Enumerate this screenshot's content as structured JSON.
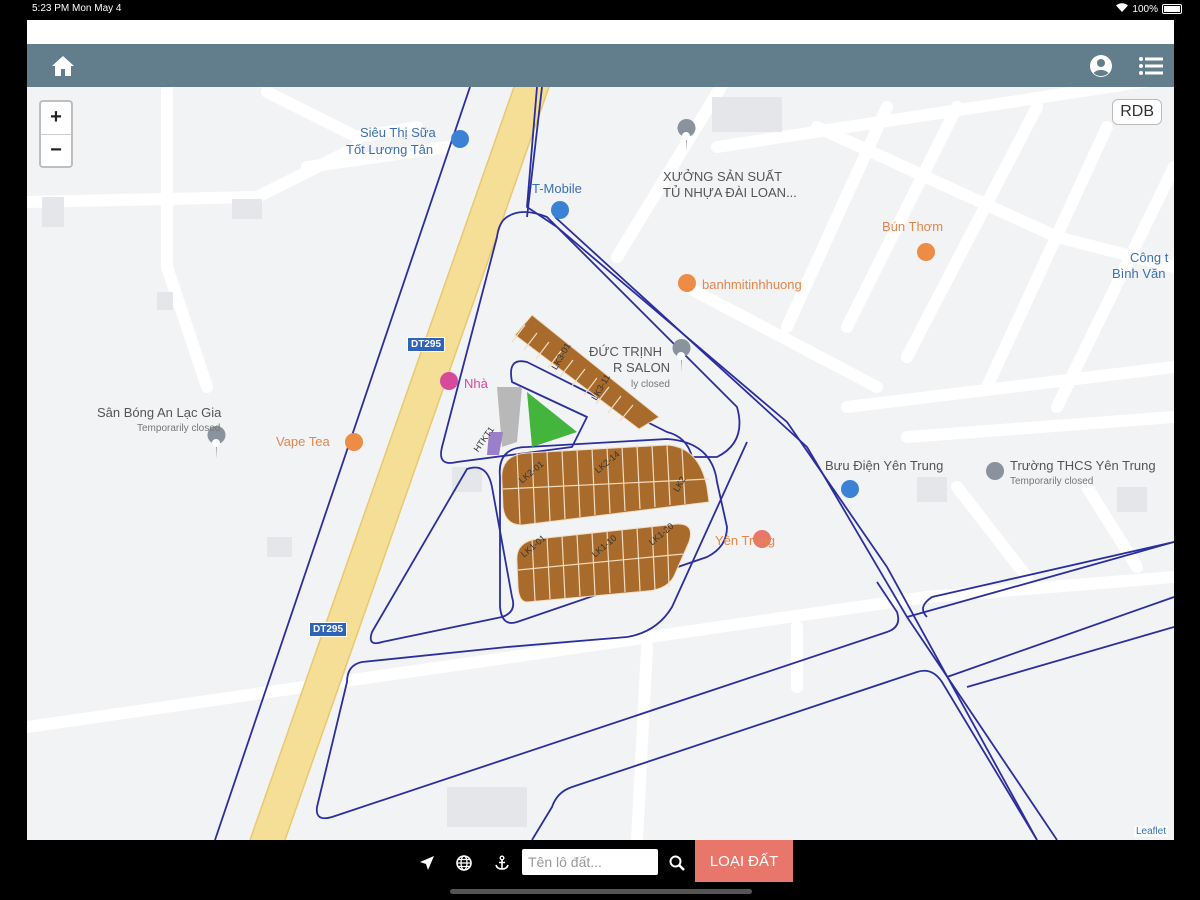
{
  "status_bar": {
    "time_date": "5:23 PM   Mon May 4",
    "battery": "100%"
  },
  "navbar": {
    "home_icon": "home-icon",
    "account_icon": "account-circle-icon",
    "menu_icon": "list-menu-icon"
  },
  "map": {
    "zoom_in": "+",
    "zoom_out": "−",
    "rdb_label": "RDB",
    "attribution": "Leaflet",
    "road_shields": [
      "DT295",
      "DT295"
    ],
    "labels": {
      "sieu_thi_1": "Siêu Thị Sữa",
      "sieu_thi_2": "Tốt Lương Tân",
      "tmobile": "T-Mobile",
      "xuong_1": "XƯỞNG SẢN SUẤT",
      "xuong_2": "TỦ NHỰA ĐÀI LOAN...",
      "bun_thom": "Bún Thơm",
      "cong_1": "Công t",
      "cong_2": "Bình Văn",
      "banhmi": "banhmitinhhuong",
      "duc_trinh_1": "ĐỨC TRỊNH",
      "duc_trinh_2": "R SALON",
      "duc_trinh_status": "ly closed",
      "nha": "Nhà",
      "san_bong": "Sân Bóng An Lạc Gia",
      "san_bong_status": "Temporarily closed",
      "vape": "Vape Tea",
      "buu_dien": "Bưu Điện Yên Trung",
      "truong": "Trường THCS Yên Trung",
      "truong_status": "Temporarily closed",
      "yen_trung": "Yên Trung"
    },
    "lot_labels": [
      "LK3-01",
      "LK3-11",
      "LK2-01",
      "LK2-14",
      "LK2",
      "LK1-01",
      "LK1-10",
      "LK1-20",
      "HTKT1"
    ],
    "colors": {
      "lot": "#a86b2c",
      "green_area": "#44b53c",
      "road_outline": "#2b2f9e",
      "highway": "#f5de96",
      "navbar": "#627d8c",
      "loai_button": "#e8766a"
    }
  },
  "toolbar": {
    "locate_icon": "navigation-arrow-icon",
    "globe_icon": "globe-icon",
    "anchor_icon": "anchor-icon",
    "search_placeholder": "Tên lô đất...",
    "search_icon": "search-icon",
    "loai_dat_label": "LOẠI ĐẤT"
  }
}
